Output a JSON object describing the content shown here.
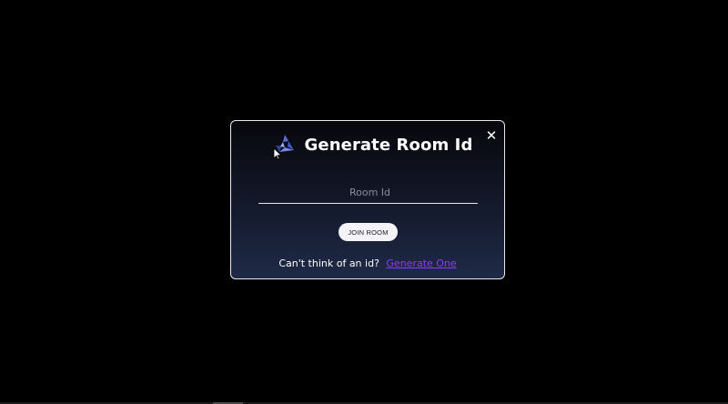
{
  "modal": {
    "title": "Generate Room Id",
    "close_glyph": "✕",
    "input": {
      "placeholder": "Room Id",
      "value": ""
    },
    "join_button_label": "JOIN ROOM",
    "footer": {
      "prompt_text": "Can't think of an id?",
      "link_text": "Generate One"
    },
    "logo_icon": "triangle-spiral-logo-icon",
    "colors": {
      "page_background": "#000000",
      "modal_gradient_top": "#07070c",
      "modal_gradient_bottom": "#1f2a47",
      "link": "#8b3ef5",
      "button_background": "#f4f4f6"
    }
  }
}
